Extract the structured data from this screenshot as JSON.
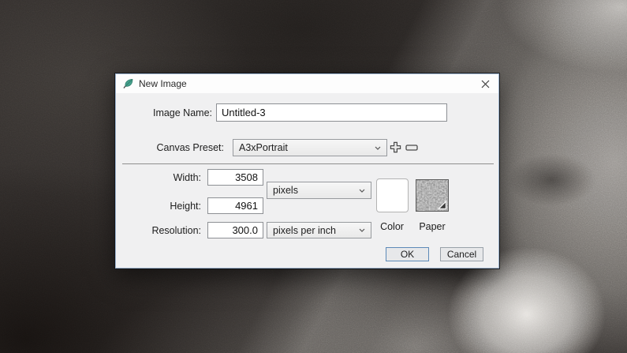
{
  "window": {
    "title": "New Image"
  },
  "form": {
    "image_name": {
      "label": "Image Name:",
      "value": "Untitled-3"
    },
    "canvas_preset": {
      "label": "Canvas Preset:",
      "value": "A3xPortrait"
    },
    "width": {
      "label": "Width:",
      "value": "3508"
    },
    "height": {
      "label": "Height:",
      "value": "4961"
    },
    "resolution": {
      "label": "Resolution:",
      "value": "300.0"
    },
    "dimension_unit": {
      "value": "pixels"
    },
    "resolution_unit": {
      "value": "pixels per inch"
    },
    "color_swatch": {
      "label": "Color",
      "value": "#ffffff"
    },
    "paper_swatch": {
      "label": "Paper"
    }
  },
  "buttons": {
    "ok": "OK",
    "cancel": "Cancel"
  },
  "icons": {
    "app": "leaf-icon",
    "close": "close-icon",
    "add_preset": "plus-icon",
    "remove_preset": "minus-icon",
    "dropdown": "chevron-down-icon",
    "paper_corner": "resize-triangle-icon"
  },
  "colors": {
    "accent_focus": "#5d8ab8",
    "dialog_bg": "#f0f0f1",
    "titlebar_bg": "#fdfdfd"
  }
}
